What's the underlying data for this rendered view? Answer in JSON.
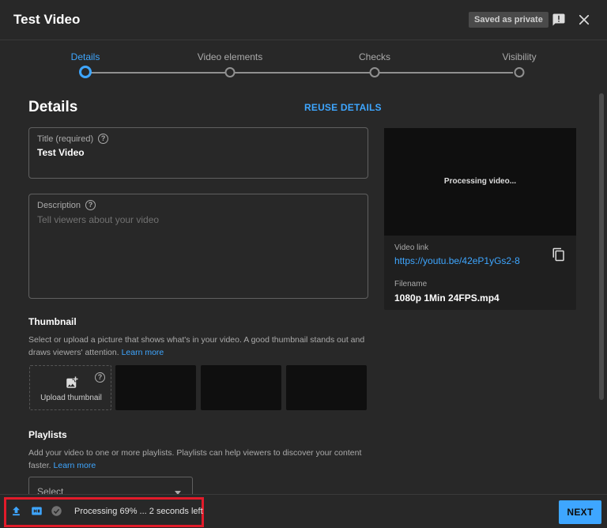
{
  "header": {
    "title": "Test Video",
    "saved_status": "Saved as private",
    "feedback_icon": "feedback-icon",
    "close_icon": "close-icon"
  },
  "stepper": {
    "steps": [
      {
        "label": "Details",
        "active": true
      },
      {
        "label": "Video elements",
        "active": false
      },
      {
        "label": "Checks",
        "active": false
      },
      {
        "label": "Visibility",
        "active": false
      }
    ]
  },
  "details": {
    "heading": "Details",
    "reuse_label": "REUSE DETAILS",
    "title_field": {
      "label": "Title (required)",
      "value": "Test Video"
    },
    "description_field": {
      "label": "Description",
      "placeholder": "Tell viewers about your video"
    }
  },
  "preview": {
    "processing": "Processing video...",
    "video_link_label": "Video link",
    "video_link": "https://youtu.be/42eP1yGs2-8",
    "filename_label": "Filename",
    "filename": "1080p 1Min 24FPS.mp4"
  },
  "thumbnail": {
    "heading": "Thumbnail",
    "description": "Select or upload a picture that shows what's in your video. A good thumbnail stands out and draws viewers' attention.",
    "learn_more": "Learn more",
    "upload_label": "Upload thumbnail"
  },
  "playlists": {
    "heading": "Playlists",
    "description": "Add your video to one or more playlists. Playlists can help viewers to discover your content faster.",
    "learn_more": "Learn more",
    "select_label": "Select"
  },
  "footer": {
    "status": "Processing 69% ... 2 seconds left",
    "next_label": "NEXT"
  },
  "colors": {
    "accent": "#3ea6ff",
    "background": "#282828",
    "highlight_border": "#e21b2a"
  }
}
